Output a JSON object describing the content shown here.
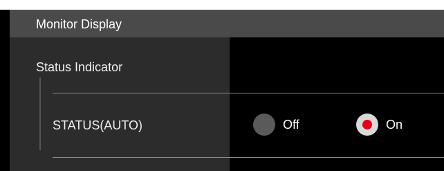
{
  "section": {
    "title": "Monitor Display"
  },
  "status_indicator": {
    "group_title": "Status Indicator",
    "row_label": "STATUS(AUTO)",
    "options": [
      {
        "label": "Off",
        "selected": false
      },
      {
        "label": "On",
        "selected": true
      }
    ]
  },
  "colors": {
    "header_bg": "#4a4a4a",
    "label_panel_bg": "#2c2c2c",
    "content_bg": "#000000",
    "radio_unselected": "#5a5a5a",
    "radio_selected_ring": "#d9d9d9",
    "radio_selected_dot": "#e1001a"
  }
}
